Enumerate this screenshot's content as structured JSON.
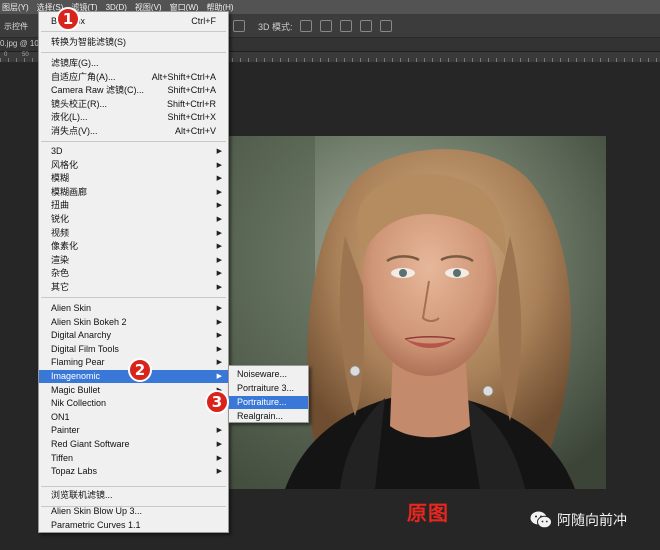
{
  "menubar": {
    "items": [
      "图层(Y)",
      "选择(S)",
      "滤镜(T)",
      "3D(D)",
      "视图(V)",
      "窗口(W)",
      "帮助(H)"
    ]
  },
  "options_bar": {
    "label": "示控件",
    "mode": "3D 模式:"
  },
  "doc_tab": {
    "label": "0.jpg @ 100"
  },
  "ruler_labels": [
    "0",
    "50",
    "100"
  ],
  "filter_menu": {
    "top_items": [
      {
        "label": "Blur Box",
        "shortcut": "Ctrl+F"
      },
      {
        "label": "转换为智能滤镜(S)",
        "shortcut": ""
      }
    ],
    "gallery_items": [
      {
        "label": "滤镜库(G)...",
        "shortcut": ""
      },
      {
        "label": "自适应广角(A)...",
        "shortcut": "Alt+Shift+Ctrl+A"
      },
      {
        "label": "Camera Raw 滤镜(C)...",
        "shortcut": "Shift+Ctrl+A"
      },
      {
        "label": "镜头校正(R)...",
        "shortcut": "Shift+Ctrl+R"
      },
      {
        "label": "液化(L)...",
        "shortcut": "Shift+Ctrl+X"
      },
      {
        "label": "消失点(V)...",
        "shortcut": "Alt+Ctrl+V"
      }
    ],
    "category_items": [
      "3D",
      "风格化",
      "模糊",
      "模糊画廊",
      "扭曲",
      "锐化",
      "视频",
      "像素化",
      "渲染",
      "杂色",
      "其它"
    ],
    "plugin_items": [
      "Alien Skin",
      "Alien Skin Bokeh 2",
      "Digital Anarchy",
      "Digital Film Tools",
      "Flaming Pear",
      "Imagenomic",
      "Magic Bullet",
      "Nik Collection",
      "ON1",
      "Painter",
      "Red Giant Software",
      "Tiffen",
      "Topaz Labs"
    ],
    "plugin_arrows": [
      true,
      true,
      true,
      true,
      true,
      true,
      true,
      true,
      false,
      true,
      true,
      true,
      true
    ],
    "highlighted": "Imagenomic",
    "browse_item": "浏览联机滤镜...",
    "bottom_items": [
      "Alien Skin Blow Up 3...",
      "Parametric Curves 1.1"
    ]
  },
  "submenu": {
    "items": [
      "Noiseware...",
      "Portraiture 3...",
      "Portraiture...",
      "Realgrain..."
    ],
    "highlighted": "Portraiture..."
  },
  "step_badges": [
    "1",
    "2",
    "3"
  ],
  "caption": "原图",
  "watermark": "阿随向前冲",
  "colors": {
    "badge": "#d9241c",
    "caption": "#e8261e",
    "highlight": "#3a78d8"
  }
}
